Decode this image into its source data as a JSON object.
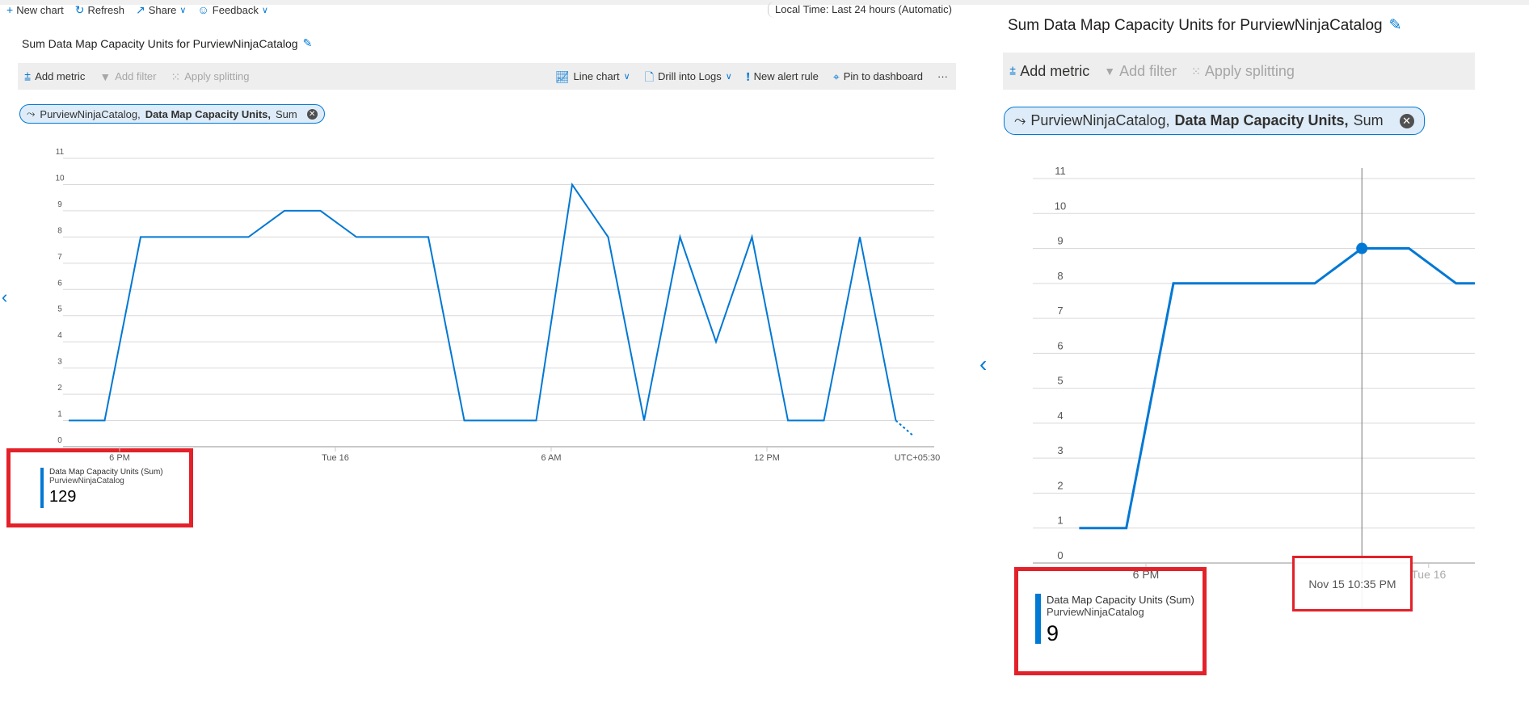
{
  "command_bar": {
    "new_chart": "New chart",
    "refresh": "Refresh",
    "share": "Share",
    "feedback": "Feedback",
    "time_range": "Local Time: Last 24 hours (Automatic)"
  },
  "chart_title": "Sum Data Map Capacity Units for PurviewNinjaCatalog",
  "chart_toolbar": {
    "add_metric": "Add metric",
    "add_filter": "Add filter",
    "apply_splitting": "Apply splitting",
    "line_chart": "Line chart",
    "drill_into_logs": "Drill into Logs",
    "new_alert_rule": "New alert rule",
    "pin_to_dashboard": "Pin to dashboard",
    "more": "···"
  },
  "metric_pill": {
    "resource": "PurviewNinjaCatalog,",
    "metric": "Data Map Capacity Units,",
    "aggregation": "Sum"
  },
  "legend_left": {
    "metric": "Data Map Capacity Units (Sum)",
    "resource": "PurviewNinjaCatalog",
    "value": "129"
  },
  "legend_right": {
    "metric": "Data Map Capacity Units (Sum)",
    "resource": "PurviewNinjaCatalog",
    "value": "9"
  },
  "tooltip": "Nov 15 10:35 PM",
  "colors": {
    "series": "#0078d4",
    "highlight": "#e3212a",
    "grid": "#d9d9d9"
  },
  "chart_data": [
    {
      "type": "line",
      "title": "Sum Data Map Capacity Units for PurviewNinjaCatalog",
      "ylim": [
        0,
        11
      ],
      "y_ticks": [
        "0",
        "1",
        "2",
        "3",
        "4",
        "5",
        "6",
        "7",
        "8",
        "9",
        "10",
        "11"
      ],
      "x_tick_labels": [
        {
          "x": "Nov 15 6:00 PM",
          "label": "6 PM"
        },
        {
          "x": "Nov 16 12:00 AM",
          "label": "Tue 16"
        },
        {
          "x": "Nov 16 6:00 AM",
          "label": "6 AM"
        },
        {
          "x": "Nov 16 12:00 PM",
          "label": "12 PM"
        }
      ],
      "timezone_label": "UTC+05:30",
      "xlim": [
        "Nov 15 4:26 PM",
        "Nov 16 4:39 PM"
      ],
      "grid": true,
      "series": [
        {
          "name": "Data Map Capacity Units (Sum)",
          "x": [
            "Nov 15 4:35 PM",
            "Nov 15 5:35 PM",
            "Nov 15 6:35 PM",
            "Nov 15 7:35 PM",
            "Nov 15 8:35 PM",
            "Nov 15 9:35 PM",
            "Nov 15 10:35 PM",
            "Nov 15 11:35 PM",
            "Nov 16 12:35 AM",
            "Nov 16 1:35 AM",
            "Nov 16 2:35 AM",
            "Nov 16 3:35 AM",
            "Nov 16 4:35 AM",
            "Nov 16 5:35 AM",
            "Nov 16 6:35 AM",
            "Nov 16 7:35 AM",
            "Nov 16 8:35 AM",
            "Nov 16 9:35 AM",
            "Nov 16 10:35 AM",
            "Nov 16 11:35 AM",
            "Nov 16 12:35 PM",
            "Nov 16 1:35 PM",
            "Nov 16 2:35 PM",
            "Nov 16 3:35 PM"
          ],
          "values": [
            1,
            1,
            8,
            8,
            8,
            8,
            9,
            9,
            8,
            8,
            8,
            1,
            1,
            1,
            10,
            8,
            1,
            8,
            4,
            8,
            1,
            1,
            8,
            1
          ],
          "incomplete_tail": {
            "x": "Nov 16 4:05 PM",
            "y": 0.4
          }
        }
      ]
    },
    {
      "type": "line",
      "title": "Sum Data Map Capacity Units for PurviewNinjaCatalog",
      "ylim": [
        0,
        11
      ],
      "y_ticks": [
        "0",
        "1",
        "2",
        "3",
        "4",
        "5",
        "6",
        "7",
        "8",
        "9",
        "10",
        "11"
      ],
      "x_tick_labels": [
        {
          "x": "Nov 15 6:00 PM",
          "label": "6 PM"
        },
        {
          "x": "Nov 16 12:00 AM",
          "label": "Tue 16"
        }
      ],
      "xlim": [
        "Nov 15 3:46 PM",
        "Nov 16 12:59 AM"
      ],
      "grid": true,
      "hover": {
        "x": "Nov 15 10:35 PM",
        "y": 9
      },
      "series": [
        {
          "name": "Data Map Capacity Units (Sum)",
          "x": [
            "Nov 15 4:35 PM",
            "Nov 15 5:35 PM",
            "Nov 15 6:35 PM",
            "Nov 15 7:35 PM",
            "Nov 15 8:35 PM",
            "Nov 15 9:35 PM",
            "Nov 15 10:35 PM",
            "Nov 15 11:35 PM",
            "Nov 16 12:35 AM",
            "Nov 16 1:35 AM"
          ],
          "values": [
            1,
            1,
            8,
            8,
            8,
            8,
            9,
            9,
            8,
            8
          ]
        }
      ]
    }
  ]
}
